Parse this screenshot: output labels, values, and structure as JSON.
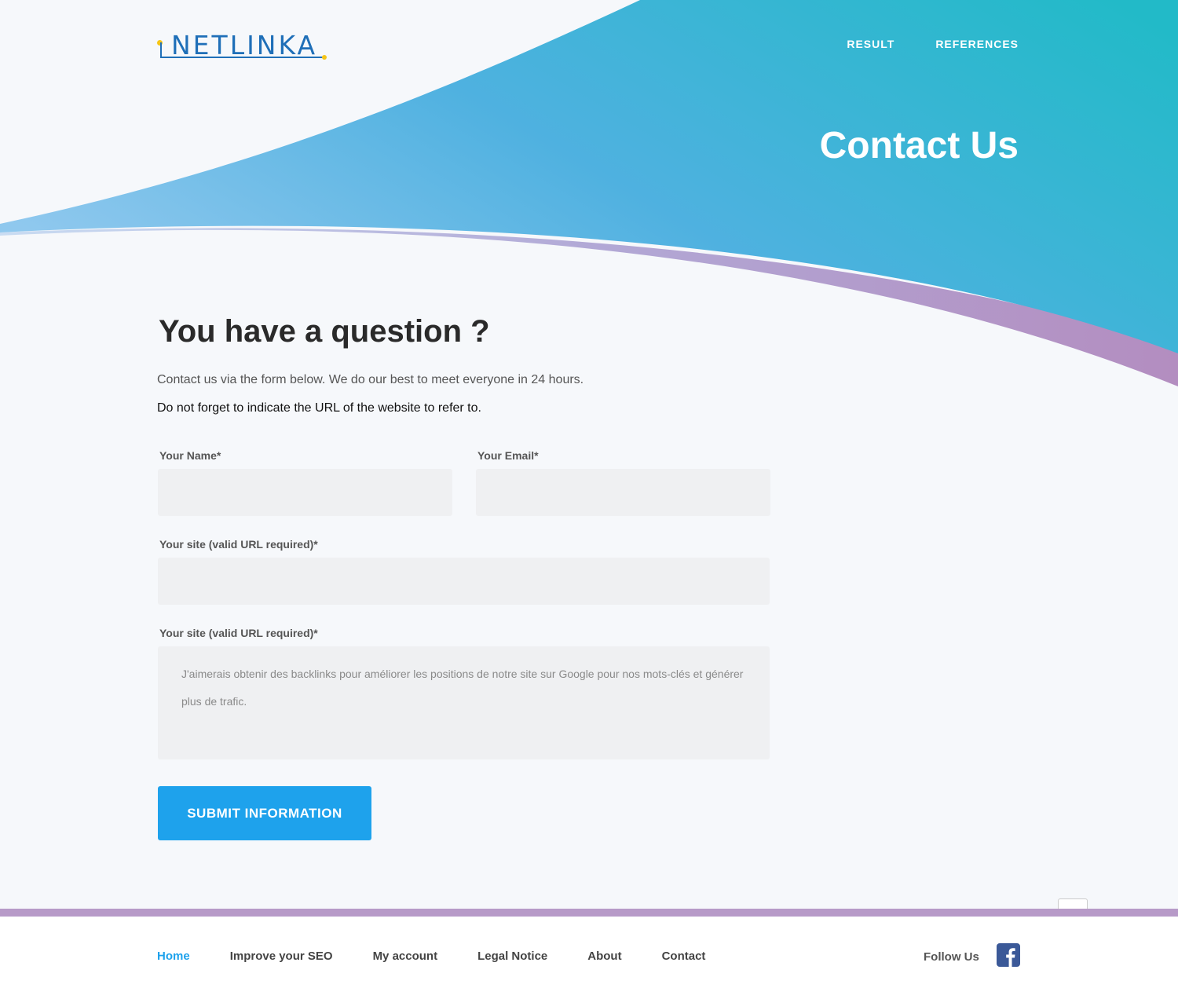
{
  "brand": {
    "logo_text": "NETLINKA"
  },
  "nav": {
    "items": [
      "RESULT",
      "REFERENCES"
    ]
  },
  "hero": {
    "title": "Contact Us"
  },
  "main": {
    "heading": "You have a question ?",
    "intro": "Contact us via the form below. We do our best to meet everyone in 24 hours.",
    "note": "Do not forget to indicate the URL of the website to refer to."
  },
  "form": {
    "name_label": "Your Name*",
    "email_label": "Your Email*",
    "site_label": "Your site (valid URL required)*",
    "message_label": "Your site (valid URL required)*",
    "message_placeholder": "J'aimerais obtenir des backlinks pour améliorer les positions de notre site sur Google pour nos mots-clés et générer plus de trafic.",
    "submit_label": "SUBMIT INFORMATION"
  },
  "footer": {
    "links": [
      "Home",
      "Improve your SEO",
      "My account",
      "Legal Notice",
      "About",
      "Contact"
    ],
    "active": "Home",
    "follow_label": "Follow Us"
  },
  "colors": {
    "accent": "#1ea2ec",
    "teal": "#26b9c9",
    "purple": "#b79ac8",
    "brand_blue": "#1f6fb8"
  }
}
